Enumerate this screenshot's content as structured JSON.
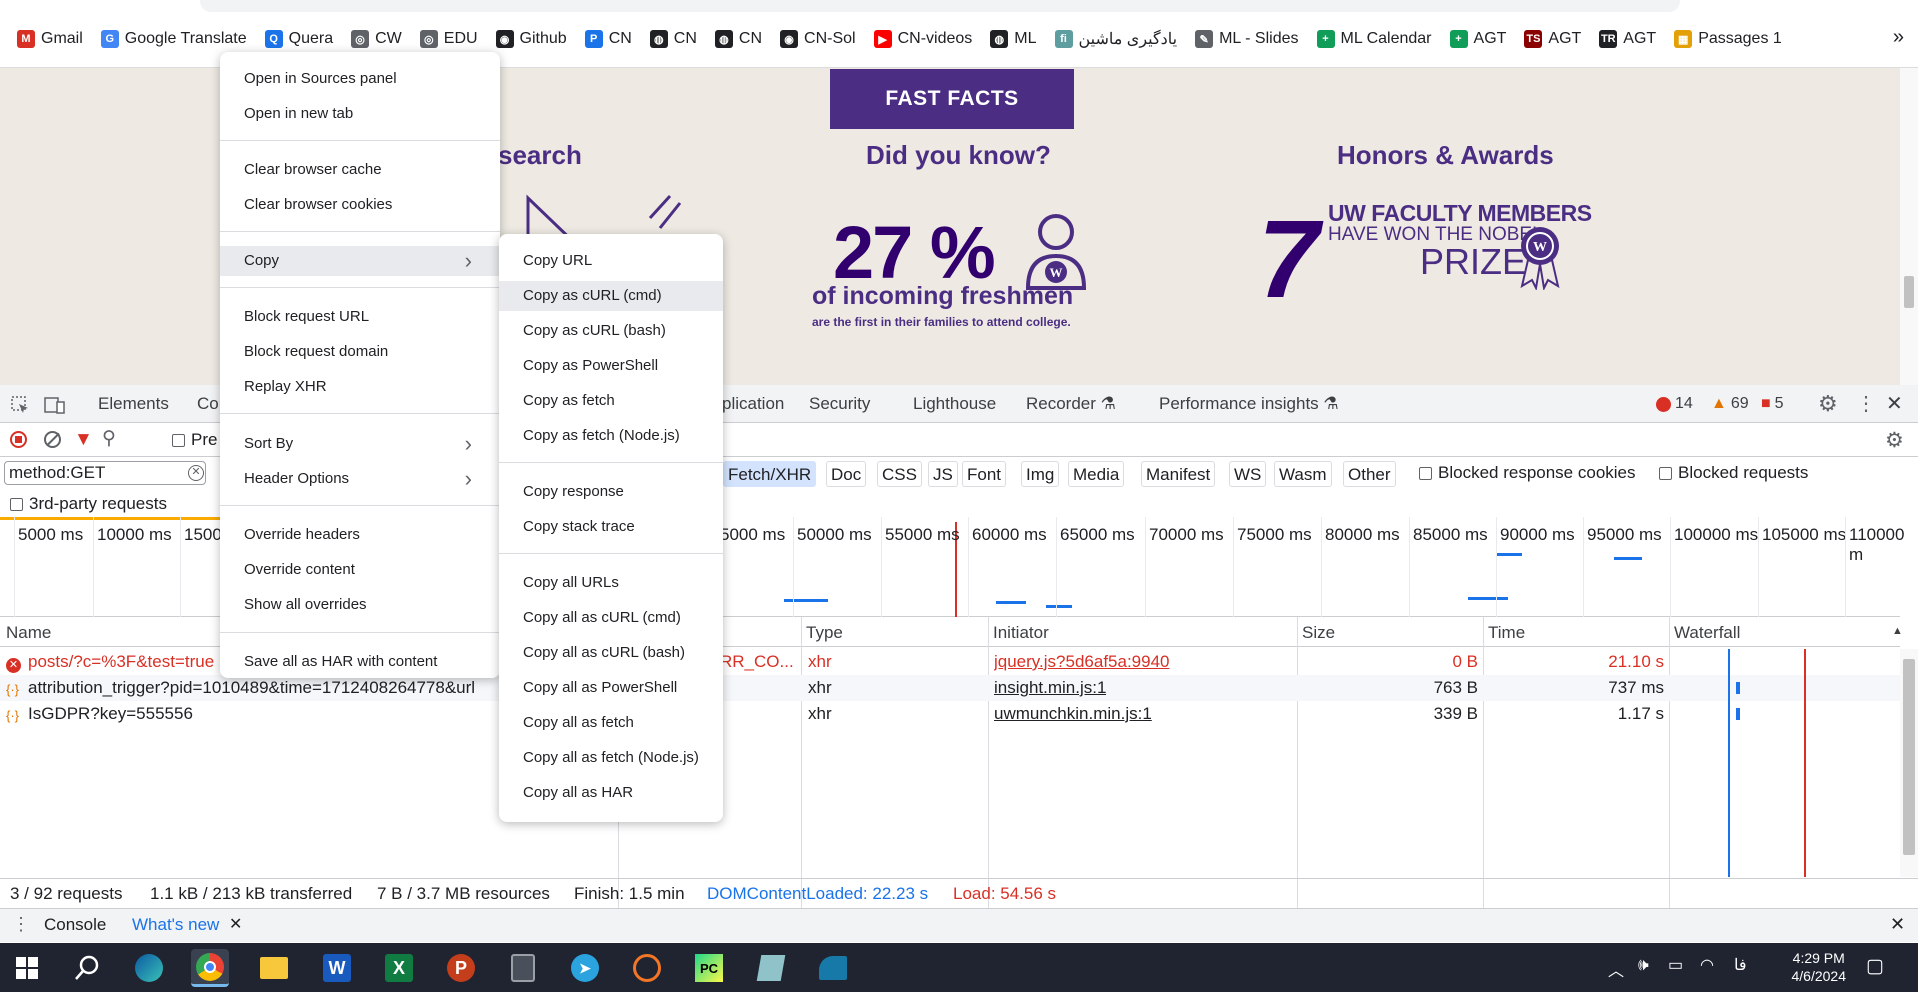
{
  "bookmarks": {
    "items": [
      {
        "label": "Gmail",
        "color": "#d93025",
        "glyph": "M"
      },
      {
        "label": "Google Translate",
        "color": "#4285f4",
        "glyph": "G"
      },
      {
        "label": "Quera",
        "color": "#1a73e8",
        "glyph": "Q"
      },
      {
        "label": "CW",
        "color": "#5f6368",
        "glyph": "◎"
      },
      {
        "label": "EDU",
        "color": "#5f6368",
        "glyph": "◎"
      },
      {
        "label": "Github",
        "color": "#202124",
        "glyph": "◉"
      },
      {
        "label": "CN",
        "color": "#1a73e8",
        "glyph": "P"
      },
      {
        "label": "CN",
        "color": "#202124",
        "glyph": "◍"
      },
      {
        "label": "CN",
        "color": "#202124",
        "glyph": "◍"
      },
      {
        "label": "CN-Sol",
        "color": "#202124",
        "glyph": "◉"
      },
      {
        "label": "CN-videos",
        "color": "#ff0000",
        "glyph": "▶"
      },
      {
        "label": "ML",
        "color": "#202124",
        "glyph": "◍"
      },
      {
        "label": "یادگیری ماشین",
        "color": "#5f9ea0",
        "glyph": "ﬁ"
      },
      {
        "label": "ML - Slides",
        "color": "#5f6368",
        "glyph": "✎"
      },
      {
        "label": "ML Calendar",
        "color": "#0f9d58",
        "glyph": "+"
      },
      {
        "label": "AGT",
        "color": "#0f9d58",
        "glyph": "+"
      },
      {
        "label": "AGT",
        "color": "#8b0000",
        "glyph": "TS"
      },
      {
        "label": "AGT",
        "color": "#202124",
        "glyph": "TR"
      },
      {
        "label": "Passages 1",
        "color": "#e3a008",
        "glyph": "▦"
      }
    ],
    "more_icon": "chevron-double-right-icon"
  },
  "webpage": {
    "fast_facts": "FAST FACTS",
    "research_title": "search",
    "did_you_know": "Did you know?",
    "honors": "Honors & Awards",
    "pct": "27 %",
    "of_incoming": "of incoming freshmen",
    "first_in_family": "are the first in their families to attend college.",
    "seven": "7",
    "uw_faculty": "UW FACULTY MEMBERS",
    "have_won": "HAVE WON THE NOBEL",
    "prize": "PRIZE"
  },
  "devtools": {
    "tabs": [
      "Elements",
      "Co",
      "plication",
      "Security",
      "Lighthouse",
      "Recorder ⚗",
      "Performance insights ⚗"
    ],
    "errors": "14",
    "warnings": "69",
    "issues": "5",
    "filter_value": "method:GET",
    "preserve_log_label": "Pre",
    "third_party_label": "3rd-party requests",
    "type_filters": [
      "Fetch/XHR",
      "Doc",
      "CSS",
      "JS",
      "Font",
      "Img",
      "Media",
      "Manifest",
      "WS",
      "Wasm",
      "Other"
    ],
    "blocked_cookies_label": "Blocked response cookies",
    "blocked_requests_label": "Blocked requests",
    "ticks": [
      "5000 ms",
      "10000 ms",
      "1500",
      "5000 ms",
      "50000 ms",
      "55000 ms",
      "60000 ms",
      "65000 ms",
      "70000 ms",
      "75000 ms",
      "80000 ms",
      "85000 ms",
      "90000 ms",
      "95000 ms",
      "100000 ms",
      "105000 ms",
      "110000 m"
    ],
    "columns": [
      "Name",
      "Type",
      "Initiator",
      "Size",
      "Time",
      "Waterfall"
    ],
    "rows": [
      {
        "name": "posts/?c=%3F&test=true",
        "status_frag": "RR_CO...",
        "type": "xhr",
        "initiator": "jquery.js?5d6af5a:9940",
        "size": "0 B",
        "time": "21.10 s",
        "error": true
      },
      {
        "name": "attribution_trigger?pid=1010489&time=1712408264778&url",
        "status_frag": "",
        "type": "xhr",
        "initiator": "insight.min.js:1",
        "size": "763 B",
        "time": "737 ms",
        "error": false
      },
      {
        "name": "IsGDPR?key=555556",
        "status_frag": "",
        "type": "xhr",
        "initiator": "uwmunchkin.min.js:1",
        "size": "339 B",
        "time": "1.17 s",
        "error": false
      }
    ],
    "status": {
      "requests": "3 / 92 requests",
      "transferred": "1.1 kB / 213 kB transferred",
      "resources": "7 B / 3.7 MB resources",
      "finish": "Finish: 1.5 min",
      "dcl": "DOMContentLoaded: 22.23 s",
      "load": "Load: 54.56 s"
    },
    "drawer": {
      "console": "Console",
      "whats_new": "What's new"
    }
  },
  "context_menu": {
    "items": [
      "Open in Sources panel",
      "Open in new tab",
      "Clear browser cache",
      "Clear browser cookies",
      "Copy",
      "Block request URL",
      "Block request domain",
      "Replay XHR",
      "Sort By",
      "Header Options",
      "Override headers",
      "Override content",
      "Show all overrides",
      "Save all as HAR with content"
    ]
  },
  "copy_submenu": {
    "items": [
      "Copy URL",
      "Copy as cURL (cmd)",
      "Copy as cURL (bash)",
      "Copy as PowerShell",
      "Copy as fetch",
      "Copy as fetch (Node.js)",
      "Copy response",
      "Copy stack trace",
      "Copy all URLs",
      "Copy all as cURL (cmd)",
      "Copy all as cURL (bash)",
      "Copy all as PowerShell",
      "Copy all as fetch",
      "Copy all as fetch (Node.js)",
      "Copy all as HAR"
    ]
  },
  "taskbar": {
    "time": "4:29 PM",
    "date": "4/6/2024",
    "lang": "فا"
  }
}
